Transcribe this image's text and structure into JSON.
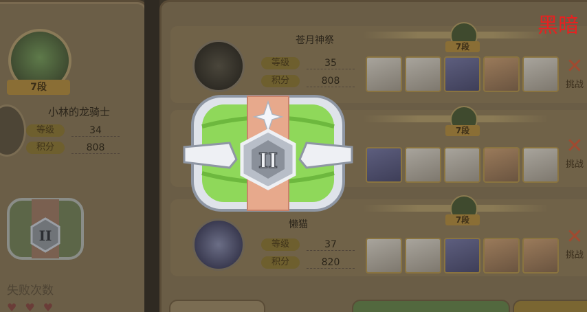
{
  "overlay_text": "黑暗",
  "player": {
    "rank": "7段",
    "name": "小林的龙骑士",
    "level_label": "等级",
    "level": "34",
    "points_label": "积分",
    "points": "808",
    "fail_label": "失败次数"
  },
  "opponents": [
    {
      "name": "苍月神祭",
      "rank": "7段",
      "level_label": "等级",
      "level": "35",
      "points_label": "积分",
      "points": "808",
      "battle_label": "挑战"
    },
    {
      "name": "",
      "rank": "7段",
      "level_label": "等级",
      "level": "",
      "points_label": "积分",
      "points": "",
      "battle_label": "挑战"
    },
    {
      "name": "懒猫",
      "rank": "7段",
      "level_label": "等级",
      "level": "37",
      "points_label": "积分",
      "points": "820",
      "battle_label": "挑战"
    }
  ],
  "reward_chest": {
    "tier": "II"
  },
  "colors": {
    "overlay_text": "#e82020",
    "chest_green": "#8fd85a",
    "chest_strap": "#e7a98c",
    "chest_silver": "#dfe3ea"
  }
}
